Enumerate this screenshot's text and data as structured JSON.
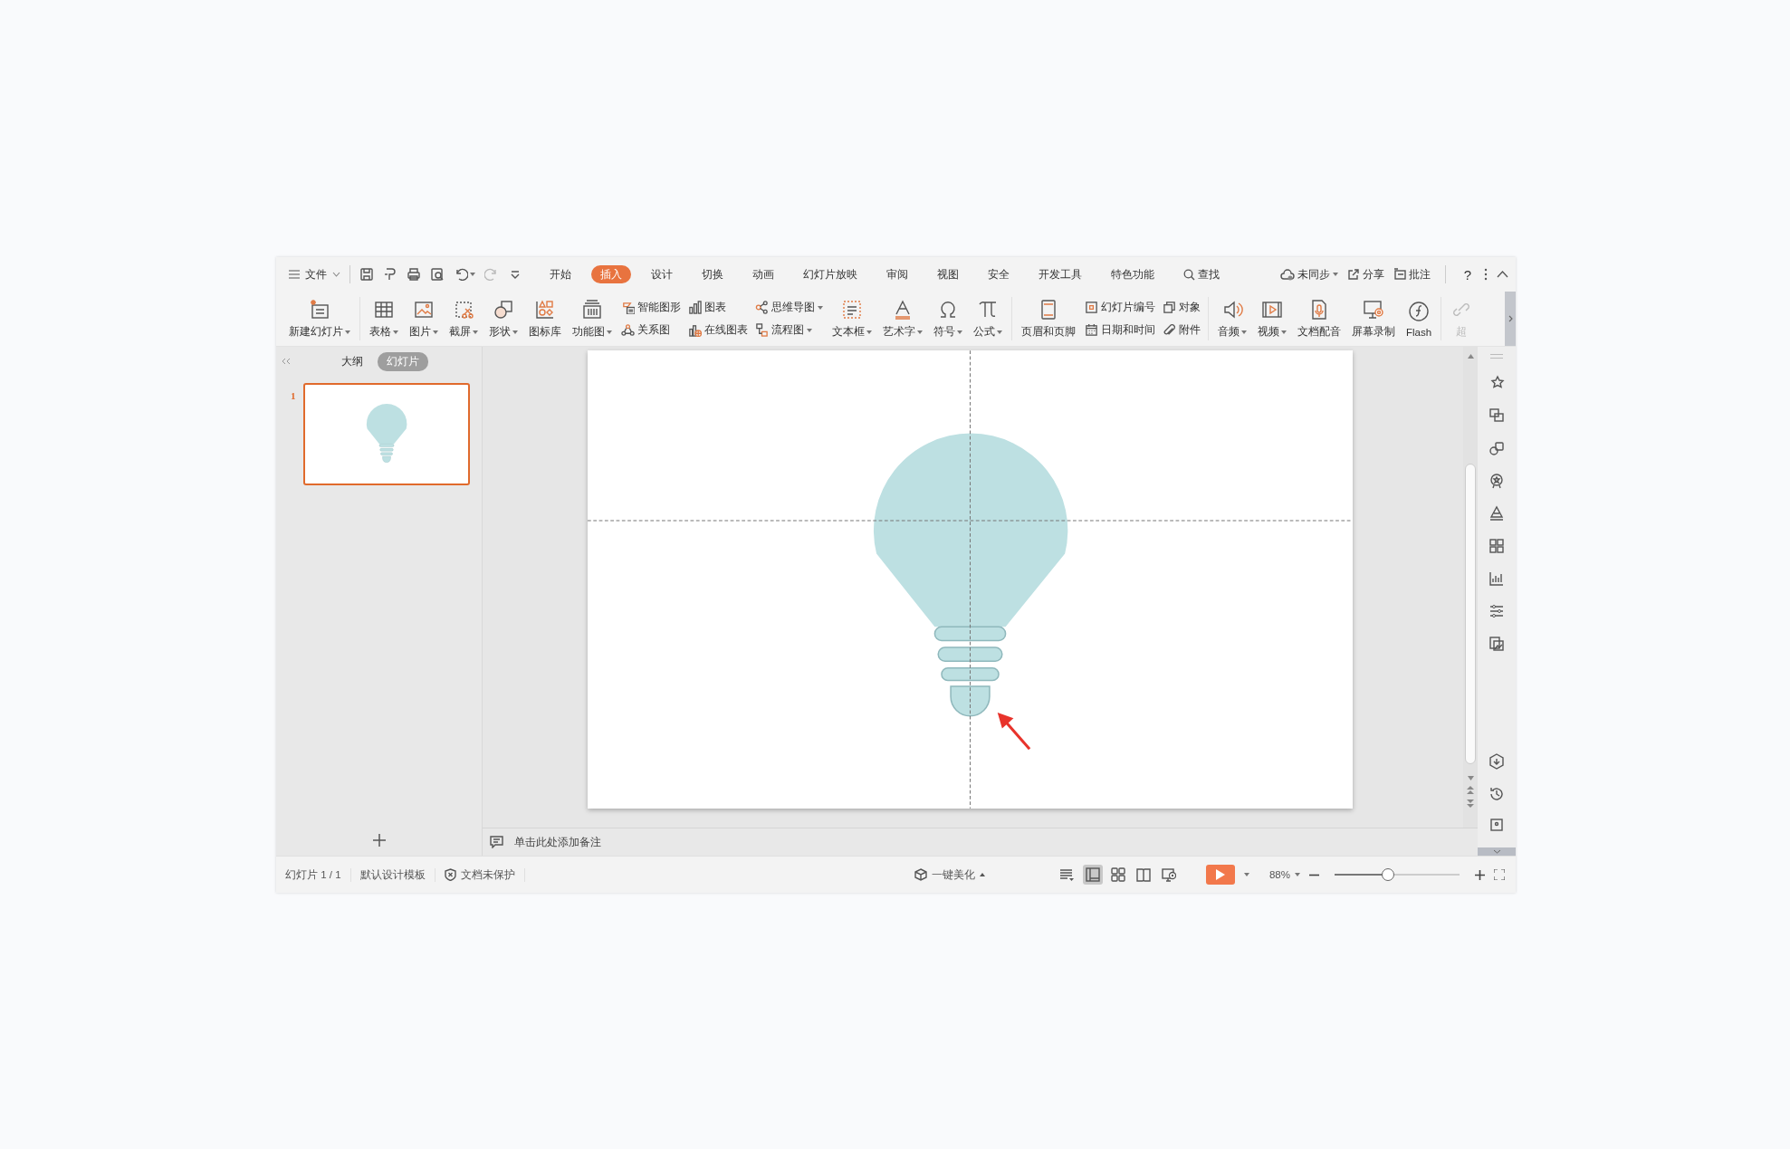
{
  "menu_bar": {
    "file_label": "文件",
    "tabs": [
      {
        "label": "开始",
        "selected": false
      },
      {
        "label": "插入",
        "selected": true
      },
      {
        "label": "设计",
        "selected": false
      },
      {
        "label": "切换",
        "selected": false
      },
      {
        "label": "动画",
        "selected": false
      },
      {
        "label": "幻灯片放映",
        "selected": false
      },
      {
        "label": "审阅",
        "selected": false
      },
      {
        "label": "视图",
        "selected": false
      },
      {
        "label": "安全",
        "selected": false
      },
      {
        "label": "开发工具",
        "selected": false
      },
      {
        "label": "特色功能",
        "selected": false
      }
    ],
    "search": "查找",
    "sync": "未同步",
    "share": "分享",
    "comment": "批注",
    "help": "?"
  },
  "ribbon": [
    {
      "kind": "large",
      "label": "新建幻灯片",
      "dropdown": true,
      "disabled": false
    },
    {
      "kind": "large",
      "label": "表格",
      "dropdown": true,
      "disabled": false
    },
    {
      "kind": "large",
      "label": "图片",
      "dropdown": true,
      "disabled": false
    },
    {
      "kind": "large",
      "label": "截屏",
      "dropdown": true,
      "disabled": false
    },
    {
      "kind": "large",
      "label": "形状",
      "dropdown": true,
      "disabled": false
    },
    {
      "kind": "large",
      "label": "图标库",
      "dropdown": false,
      "disabled": false
    },
    {
      "kind": "large",
      "label": "功能图",
      "dropdown": true,
      "disabled": false
    },
    {
      "kind": "stack",
      "items": [
        {
          "label": "智能图形",
          "dropdown": false
        },
        {
          "label": "关系图",
          "dropdown": false
        }
      ]
    },
    {
      "kind": "stack",
      "items": [
        {
          "label": "图表",
          "dropdown": false
        },
        {
          "label": "在线图表",
          "dropdown": false
        }
      ]
    },
    {
      "kind": "stack",
      "items": [
        {
          "label": "思维导图",
          "dropdown": true
        },
        {
          "label": "流程图",
          "dropdown": true
        }
      ]
    },
    {
      "kind": "large",
      "label": "文本框",
      "dropdown": true,
      "disabled": false
    },
    {
      "kind": "large",
      "label": "艺术字",
      "dropdown": true,
      "disabled": false
    },
    {
      "kind": "large",
      "label": "符号",
      "dropdown": true,
      "disabled": false
    },
    {
      "kind": "large",
      "label": "公式",
      "dropdown": true,
      "disabled": false
    },
    {
      "kind": "large",
      "label": "页眉和页脚",
      "dropdown": false,
      "disabled": false
    },
    {
      "kind": "stack",
      "items": [
        {
          "label": "幻灯片编号",
          "dropdown": false
        },
        {
          "label": "日期和时间",
          "dropdown": false
        }
      ]
    },
    {
      "kind": "stack",
      "items": [
        {
          "label": "对象",
          "dropdown": false
        },
        {
          "label": "附件",
          "dropdown": false
        }
      ]
    },
    {
      "kind": "large",
      "label": "音频",
      "dropdown": true,
      "disabled": false
    },
    {
      "kind": "large",
      "label": "视频",
      "dropdown": true,
      "disabled": false
    },
    {
      "kind": "large",
      "label": "文档配音",
      "dropdown": false,
      "disabled": false
    },
    {
      "kind": "large",
      "label": "屏幕录制",
      "dropdown": false,
      "disabled": false
    },
    {
      "kind": "large",
      "label": "Flash",
      "dropdown": false,
      "disabled": false
    },
    {
      "kind": "large",
      "label": "超",
      "dropdown": false,
      "disabled": true
    }
  ],
  "side_panel": {
    "tabs": [
      {
        "label": "大纲",
        "selected": false
      },
      {
        "label": "幻灯片",
        "selected": true
      }
    ],
    "slides": [
      {
        "number": "1",
        "selected": true
      }
    ]
  },
  "notes": {
    "placeholder": "单击此处添加备注"
  },
  "status_bar": {
    "slide_info": "幻灯片 1 / 1",
    "template": "默认设计模板",
    "protection": "文档未保护",
    "beautify": "一键美化",
    "views": [
      {
        "kind": "normal",
        "selected": true
      },
      {
        "kind": "sorter",
        "selected": false
      },
      {
        "kind": "reading",
        "selected": false
      },
      {
        "kind": "presenter",
        "selected": false
      }
    ],
    "zoom": "88%",
    "zoom_slider": {
      "level": 0.43
    }
  }
}
